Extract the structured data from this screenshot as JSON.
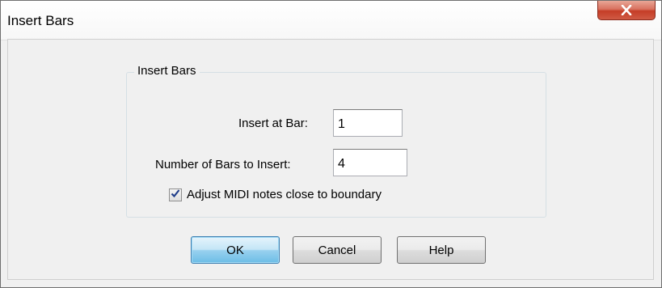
{
  "window": {
    "title": "Insert Bars",
    "close_icon": "close-icon"
  },
  "group": {
    "label": "Insert Bars"
  },
  "fields": {
    "insert_at_bar": {
      "label": "Insert at Bar:",
      "value": "1"
    },
    "number_of_bars": {
      "label": "Number of Bars to Insert:",
      "value": "4"
    }
  },
  "options": {
    "adjust_midi": {
      "label": "Adjust MIDI notes close to boundary",
      "checked": true
    }
  },
  "buttons": {
    "ok": "OK",
    "cancel": "Cancel",
    "help": "Help"
  },
  "colors": {
    "close_button": "#c53d27",
    "default_button": "#98d1ef",
    "check_mark": "#1f3d8a"
  }
}
